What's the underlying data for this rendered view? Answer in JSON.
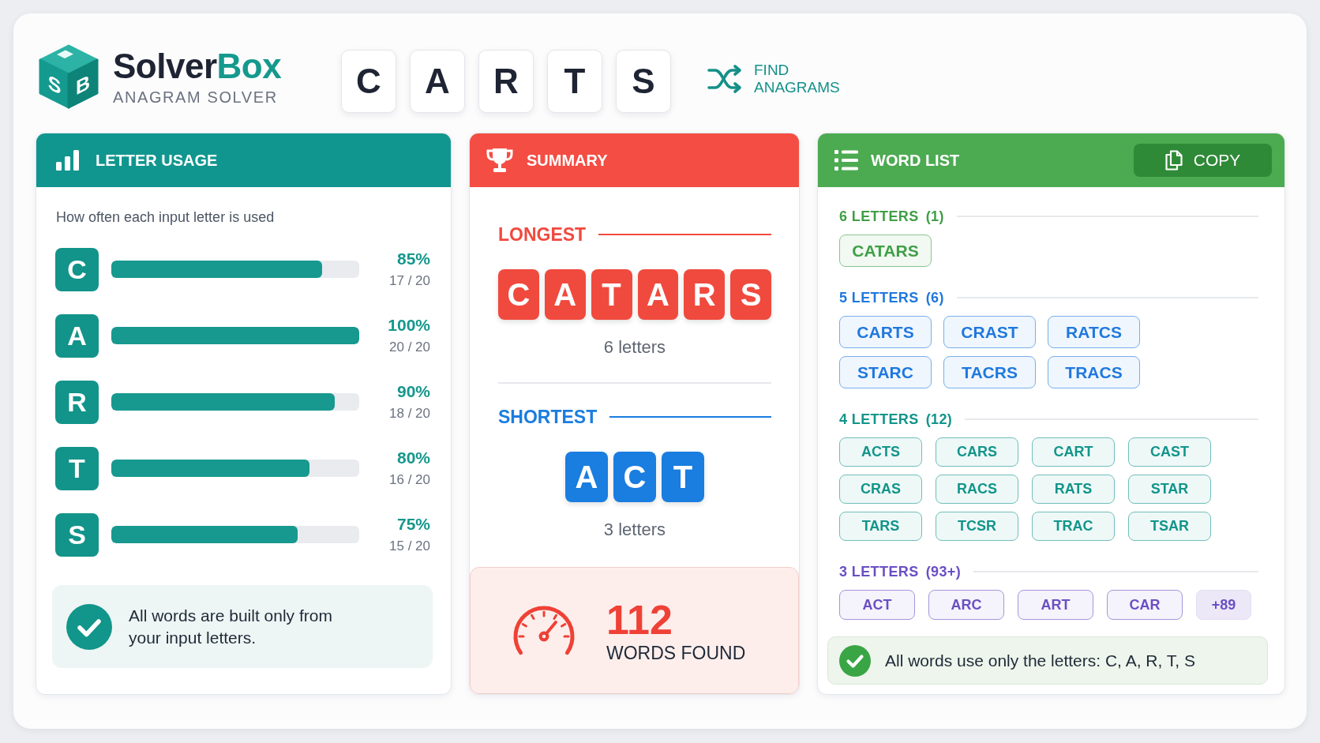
{
  "brand": {
    "logo_letters": [
      "S",
      "B"
    ],
    "name_parts": [
      "Solver",
      "Box"
    ],
    "tagline": "ANAGRAM SOLVER"
  },
  "input_letters": [
    "C",
    "A",
    "R",
    "T",
    "S"
  ],
  "find_button": {
    "label": "FIND ANAGRAMS"
  },
  "letter_usage": {
    "title": "LETTER USAGE",
    "subtitle": "How often each input letter is used",
    "rows": [
      {
        "letter": "C",
        "level": 0.85,
        "percent": "85%",
        "count": "17 / 20"
      },
      {
        "letter": "A",
        "level": 1.0,
        "percent": "100%",
        "count": "20 / 20"
      },
      {
        "letter": "R",
        "level": 0.9,
        "percent": "90%",
        "count": "18 / 20"
      },
      {
        "letter": "T",
        "level": 0.8,
        "percent": "80%",
        "count": "16 / 20"
      },
      {
        "letter": "S",
        "level": 0.75,
        "percent": "75%",
        "count": "15 / 20"
      }
    ],
    "note": "All words are built only from your input letters."
  },
  "summary": {
    "title": "SUMMARY",
    "sections": [
      {
        "label": "LONGEST",
        "color": "#f04a3e",
        "letters": [
          "C",
          "A",
          "T",
          "A",
          "R",
          "S"
        ],
        "caption": "6 letters"
      },
      {
        "label": "SHORTEST",
        "color": "#1a7de0",
        "letters": [
          "A",
          "C",
          "T"
        ],
        "caption": "3 letters"
      }
    ],
    "total": {
      "value": "112",
      "label": "WORDS FOUND"
    }
  },
  "word_list": {
    "title": "WORD LIST",
    "copy_button": "COPY",
    "groups": [
      {
        "label": "6 LETTERS",
        "count": "(1)",
        "color": "#3f9f46",
        "words": [
          "CATARS"
        ]
      },
      {
        "label": "5 LETTERS",
        "count": "(6)",
        "color": "#1f78de",
        "words": [
          "CARTS",
          "CRAST",
          "RATCS",
          "STARC",
          "TACRS",
          "TRACS"
        ]
      },
      {
        "label": "4 LETTERS",
        "count": "(12)",
        "color": "#12958a",
        "words": [
          "ACTS",
          "CARS",
          "CART",
          "CAST",
          "CRAS",
          "RACS",
          "RATS",
          "STAR",
          "TARS",
          "TCSR",
          "TRAC",
          "TSAR"
        ]
      },
      {
        "label": "3 LETTERS",
        "count": "(93+)",
        "color": "#6a4fc4",
        "words": [
          "ACT",
          "ARC",
          "ART",
          "CAR"
        ],
        "more": "+89"
      }
    ],
    "note": "All words use only the letters: C, A, R, T, S"
  }
}
